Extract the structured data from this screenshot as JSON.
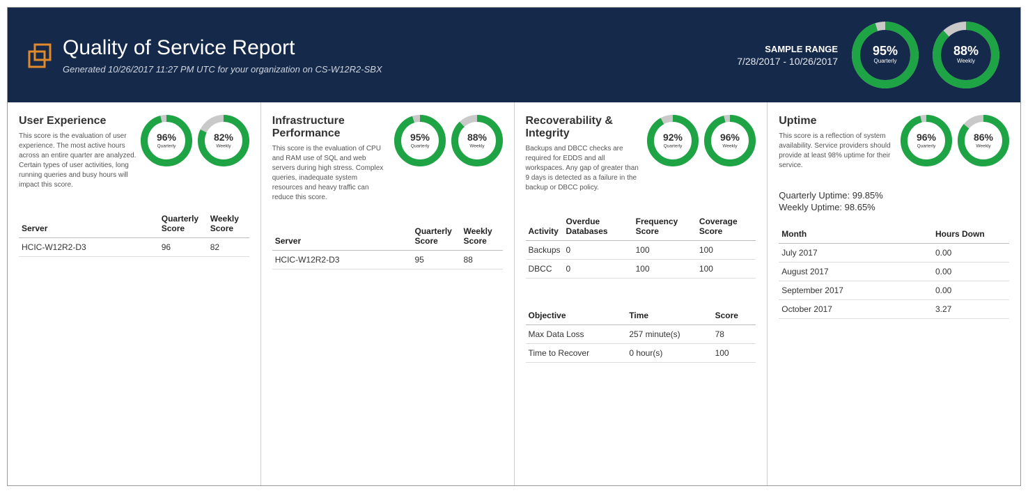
{
  "header": {
    "title": "Quality of Service Report",
    "subtitle": "Generated 10/26/2017 11:27 PM UTC for your organization on CS-W12R2-SBX",
    "sample_range_label": "SAMPLE RANGE",
    "sample_range_dates": "7/28/2017 - 10/26/2017",
    "quarterly_pct": "95%",
    "quarterly_label": "Quarterly",
    "weekly_pct": "88%",
    "weekly_label": "Weekly"
  },
  "panels": {
    "ux": {
      "title": "User Experience",
      "desc": "This score is the evaluation of user experience. The most active hours across an entire quarter are analyzed. Certain types of user activities, long running queries and busy hours will impact this score.",
      "q_pct": "96%",
      "q_lbl": "Quarterly",
      "w_pct": "82%",
      "w_lbl": "Weekly",
      "table_headers": {
        "server": "Server",
        "q": "Quarterly Score",
        "w": "Weekly Score"
      },
      "row": {
        "server": "HCIC-W12R2-D3",
        "q": "96",
        "w": "82"
      }
    },
    "infra": {
      "title": "Infrastructure Performance",
      "desc": "This score is the evaluation of CPU and RAM use of SQL and web servers during high stress. Complex queries, inadequate system resources and heavy traffic can reduce this score.",
      "q_pct": "95%",
      "q_lbl": "Quarterly",
      "w_pct": "88%",
      "w_lbl": "Weekly",
      "table_headers": {
        "server": "Server",
        "q": "Quarterly Score",
        "w": "Weekly Score"
      },
      "row": {
        "server": "HCIC-W12R2-D3",
        "q": "95",
        "w": "88"
      }
    },
    "recov": {
      "title": "Recoverability & Integrity",
      "desc": "Backups and DBCC checks are required for EDDS and all workspaces. Any gap of greater than 9 days is detected as a failure in the backup or DBCC policy.",
      "q_pct": "92%",
      "q_lbl": "Quarterly",
      "w_pct": "96%",
      "w_lbl": "Weekly",
      "t1_headers": {
        "activity": "Activity",
        "overdue": "Overdue Databases",
        "freq": "Frequency Score",
        "cov": "Coverage Score"
      },
      "t1_rows": {
        "r0": {
          "activity": "Backups",
          "overdue": "0",
          "freq": "100",
          "cov": "100"
        },
        "r1": {
          "activity": "DBCC",
          "overdue": "0",
          "freq": "100",
          "cov": "100"
        }
      },
      "t2_headers": {
        "objective": "Objective",
        "time": "Time",
        "score": "Score"
      },
      "t2_rows": {
        "r0": {
          "objective": "Max Data Loss",
          "time": "257 minute(s)",
          "score": "78"
        },
        "r1": {
          "objective": "Time to Recover",
          "time": "0 hour(s)",
          "score": "100"
        }
      }
    },
    "uptime": {
      "title": "Uptime",
      "desc": "This score is a reflection of system availability. Service providers should provide at least 98% uptime for their service.",
      "q_pct": "96%",
      "q_lbl": "Quarterly",
      "w_pct": "86%",
      "w_lbl": "Weekly",
      "q_uptime_line": "Quarterly Uptime: 99.85%",
      "w_uptime_line": "Weekly Uptime: 98.65%",
      "table_headers": {
        "month": "Month",
        "hours": "Hours Down"
      },
      "rows": {
        "r0": {
          "month": "July 2017",
          "hours": "0.00"
        },
        "r1": {
          "month": "August 2017",
          "hours": "0.00"
        },
        "r2": {
          "month": "September 2017",
          "hours": "0.00"
        },
        "r3": {
          "month": "October 2017",
          "hours": "3.27"
        }
      }
    }
  },
  "chart_data": [
    {
      "type": "pie",
      "location": "header-quarterly",
      "title": "Quarterly",
      "values": [
        95,
        5
      ],
      "colors": [
        "#1ea445",
        "#c9c9c9"
      ]
    },
    {
      "type": "pie",
      "location": "header-weekly",
      "title": "Weekly",
      "values": [
        88,
        12
      ],
      "colors": [
        "#1ea445",
        "#c9c9c9"
      ]
    },
    {
      "type": "pie",
      "location": "ux-quarterly",
      "title": "Quarterly",
      "values": [
        96,
        4
      ],
      "colors": [
        "#1ea445",
        "#c9c9c9"
      ]
    },
    {
      "type": "pie",
      "location": "ux-weekly",
      "title": "Weekly",
      "values": [
        82,
        18
      ],
      "colors": [
        "#1ea445",
        "#c9c9c9"
      ]
    },
    {
      "type": "pie",
      "location": "infra-quarterly",
      "title": "Quarterly",
      "values": [
        95,
        5
      ],
      "colors": [
        "#1ea445",
        "#c9c9c9"
      ]
    },
    {
      "type": "pie",
      "location": "infra-weekly",
      "title": "Weekly",
      "values": [
        88,
        12
      ],
      "colors": [
        "#1ea445",
        "#c9c9c9"
      ]
    },
    {
      "type": "pie",
      "location": "recov-quarterly",
      "title": "Quarterly",
      "values": [
        92,
        8
      ],
      "colors": [
        "#1ea445",
        "#c9c9c9"
      ]
    },
    {
      "type": "pie",
      "location": "recov-weekly",
      "title": "Weekly",
      "values": [
        96,
        4
      ],
      "colors": [
        "#1ea445",
        "#c9c9c9"
      ]
    },
    {
      "type": "pie",
      "location": "uptime-quarterly",
      "title": "Quarterly",
      "values": [
        96,
        4
      ],
      "colors": [
        "#1ea445",
        "#c9c9c9"
      ]
    },
    {
      "type": "pie",
      "location": "uptime-weekly",
      "title": "Weekly",
      "values": [
        86,
        14
      ],
      "colors": [
        "#1ea445",
        "#c9c9c9"
      ]
    }
  ]
}
